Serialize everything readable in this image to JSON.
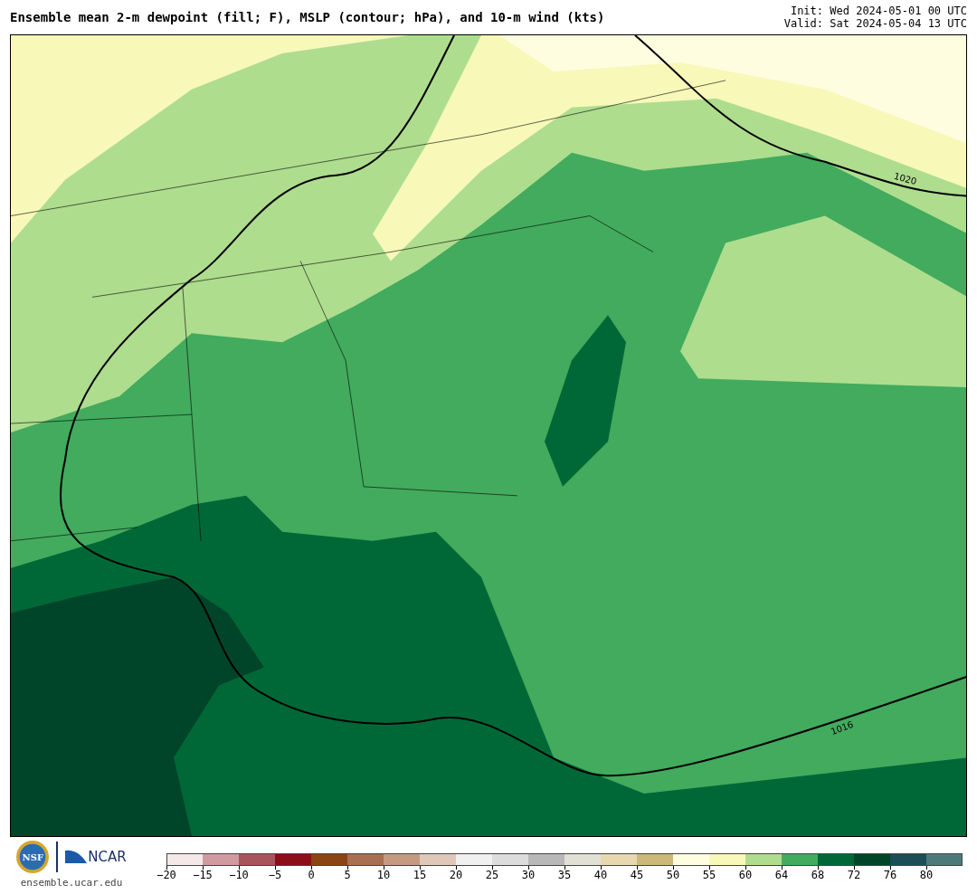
{
  "header": {
    "title": "Ensemble mean 2-m dewpoint (fill; F), MSLP (contour; hPa), and 10-m wind (kts)",
    "init": "Init: Wed 2024-05-01 00 UTC",
    "valid": "Valid: Sat 2024-05-04 13 UTC"
  },
  "map": {
    "contour_labels": [
      {
        "label": "1020"
      },
      {
        "label": "1016"
      }
    ]
  },
  "footer": {
    "nsf": "NSF",
    "ncar": "NCAR",
    "url": "ensemble.ucar.edu"
  },
  "colorbar": {
    "bins": [
      {
        "label": "−20",
        "color": "#f5e8e8"
      },
      {
        "label": "−15",
        "color": "#d09aa0"
      },
      {
        "label": "−10",
        "color": "#a8545c"
      },
      {
        "label": "−5",
        "color": "#8b0e1a"
      },
      {
        "label": "0",
        "color": "#8b4513"
      },
      {
        "label": "5",
        "color": "#a87050"
      },
      {
        "label": "10",
        "color": "#c49a80"
      },
      {
        "label": "15",
        "color": "#e0c8b8"
      },
      {
        "label": "20",
        "color": "#f0f0f0"
      },
      {
        "label": "25",
        "color": "#dcdcdc"
      },
      {
        "label": "30",
        "color": "#b8b8b8"
      },
      {
        "label": "35",
        "color": "#e0e0d4"
      },
      {
        "label": "40",
        "color": "#e8d8b0"
      },
      {
        "label": "45",
        "color": "#cdb878"
      },
      {
        "label": "50",
        "color": "#fffde0"
      },
      {
        "label": "55",
        "color": "#f8f8b8"
      },
      {
        "label": "60",
        "color": "#aedd8e"
      },
      {
        "label": "64",
        "color": "#42ab5d"
      },
      {
        "label": "68",
        "color": "#006837"
      },
      {
        "label": "72",
        "color": "#004529"
      },
      {
        "label": "76",
        "color": "#1b4e56"
      },
      {
        "label": "80",
        "color": "#4c7a7a"
      }
    ]
  }
}
